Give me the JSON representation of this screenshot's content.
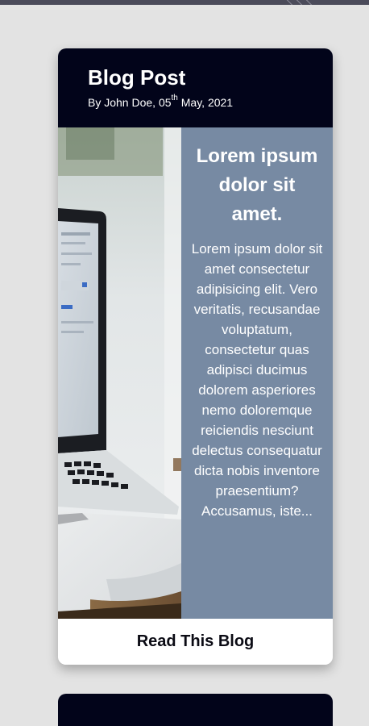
{
  "post": {
    "title": "Blog Post",
    "meta_prefix": "By John Doe, 05",
    "meta_sup": "th",
    "meta_suffix": " May, 2021",
    "subtitle": "Lorem ipsum dolor sit amet.",
    "excerpt": "Lorem ipsum dolor sit amet consectetur adipisicing elit. Vero veritatis, recusandae voluptatum, consectetur quas adipisci ducimus dolorem asperiores nemo doloremque reiciendis nesciunt delectus consequatur dicta nobis inventore praesentium? Accusamus, iste...",
    "button_label": "Read This Blog",
    "image_subject": "laptop-and-notebook"
  },
  "colors": {
    "page_background": "#e3e3e3",
    "header_background": "#02041a",
    "body_panel": "#778aa3",
    "text_light": "#ffffff",
    "button_text": "#0b0b14"
  }
}
